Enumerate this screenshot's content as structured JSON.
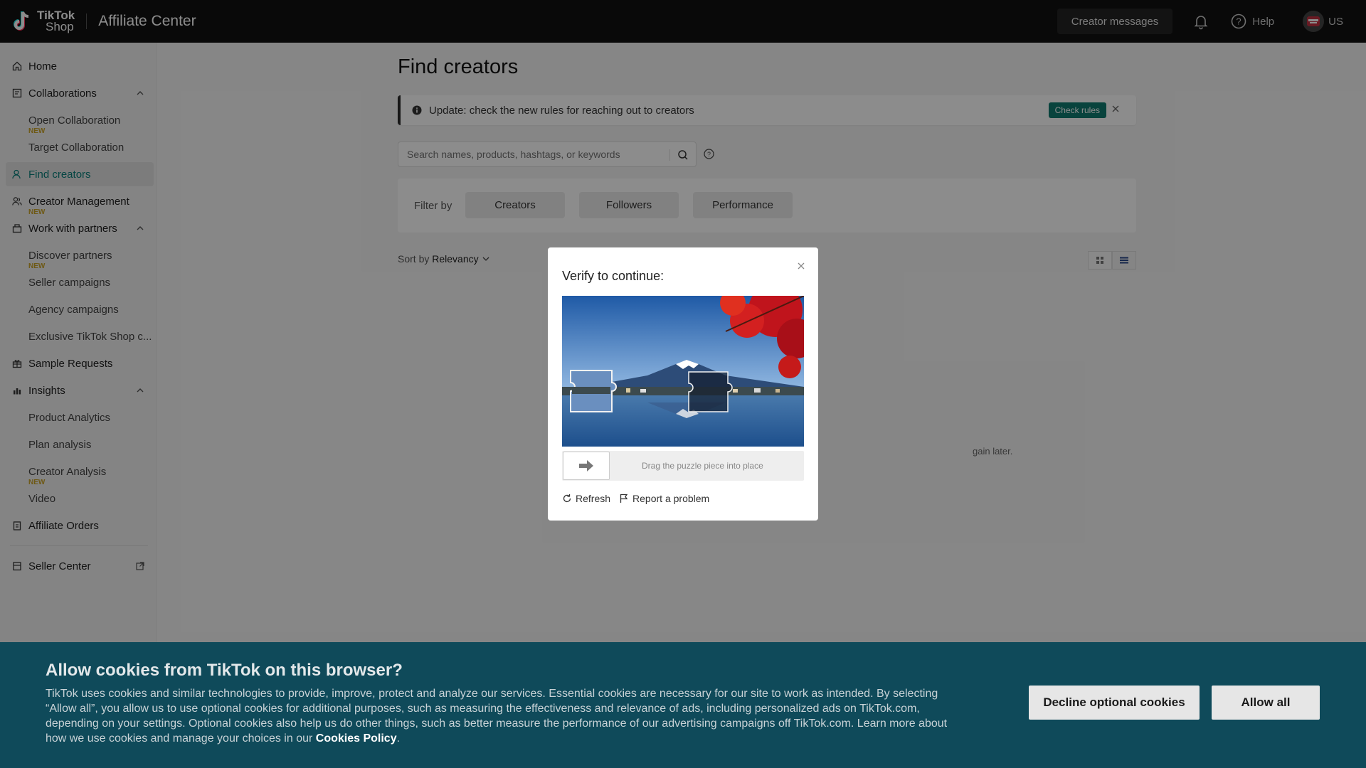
{
  "header": {
    "logo_line1": "TikTok",
    "logo_line2": "Shop",
    "app_title": "Affiliate Center",
    "creator_messages": "Creator messages",
    "help": "Help",
    "region": "US"
  },
  "sidebar": {
    "items": [
      {
        "label": "Home"
      },
      {
        "label": "Collaborations"
      },
      {
        "label": "Open Collaboration",
        "badge": "NEW"
      },
      {
        "label": "Target Collaboration"
      },
      {
        "label": "Find creators"
      },
      {
        "label": "Creator Management",
        "badge": "NEW"
      },
      {
        "label": "Work with partners"
      },
      {
        "label": "Discover partners",
        "badge": "NEW"
      },
      {
        "label": "Seller campaigns"
      },
      {
        "label": "Agency campaigns"
      },
      {
        "label": "Exclusive TikTok Shop c..."
      },
      {
        "label": "Sample Requests"
      },
      {
        "label": "Insights"
      },
      {
        "label": "Product Analytics"
      },
      {
        "label": "Plan analysis"
      },
      {
        "label": "Creator Analysis",
        "badge": "NEW"
      },
      {
        "label": "Video"
      },
      {
        "label": "Affiliate Orders"
      },
      {
        "label": "Seller Center"
      }
    ]
  },
  "main": {
    "title": "Find creators",
    "notice": "Update: check the new rules for reaching out to creators",
    "check_rules": "Check rules",
    "search_placeholder": "Search names, products, hashtags, or keywords",
    "filter_label": "Filter by",
    "filters": [
      "Creators",
      "Followers",
      "Performance"
    ],
    "sort_label": "Sort by",
    "sort_value": "Relevancy",
    "background_message": "gain later."
  },
  "captcha": {
    "title": "Verify to continue:",
    "hint": "Drag the puzzle piece into place",
    "refresh": "Refresh",
    "report": "Report a problem"
  },
  "cookie": {
    "title": "Allow cookies from TikTok on this browser?",
    "body": "TikTok uses cookies and similar technologies to provide, improve, protect and analyze our services. Essential cookies are necessary for our site to work as intended. By selecting “Allow all”, you allow us to use optional cookies for additional purposes, such as measuring the effectiveness and relevance of ads, including personalized ads on TikTok.com, depending on your settings. Optional cookies also help us do other things, such as better measure the performance of our advertising campaigns off TikTok.com. Learn more about how we use cookies and manage your choices in our",
    "policy_link": "Cookies Policy",
    "period": ".",
    "decline": "Decline optional cookies",
    "allow": "Allow all"
  },
  "colors": {
    "accent": "#0f7a6f",
    "topbar": "#121212",
    "cookie_bg": "#0f4a5a",
    "new_badge": "#c9a227"
  }
}
